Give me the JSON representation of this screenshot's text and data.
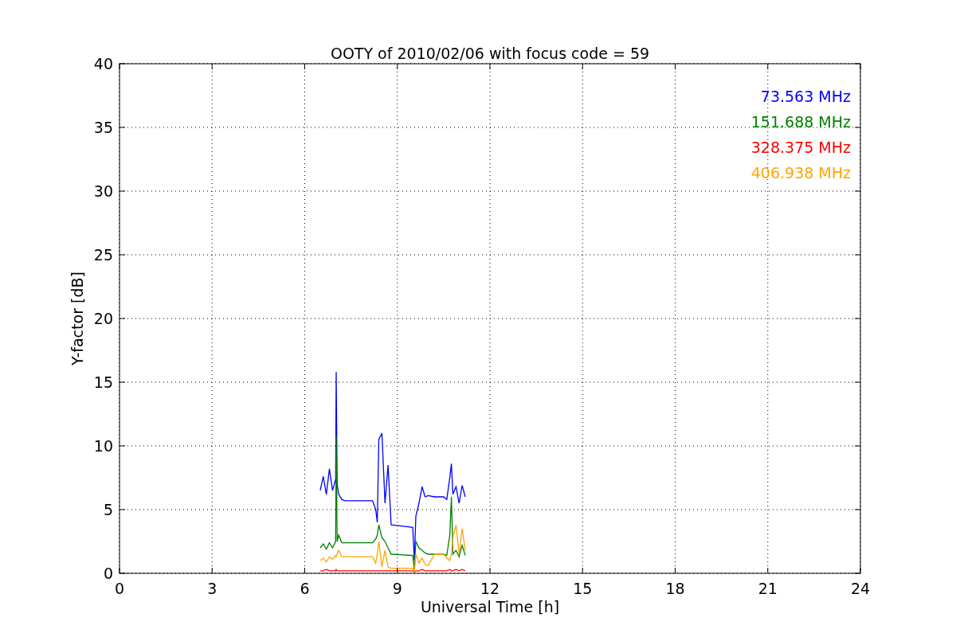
{
  "figure": {
    "chart_data": {
      "type": "line",
      "title": "OOTY of 2010/02/06 with focus code = 59",
      "xlabel": "Universal Time [h]",
      "ylabel": "Y-factor [dB]",
      "x": [
        6.5,
        6.6,
        6.7,
        6.8,
        6.9,
        7.0,
        7.02,
        7.05,
        7.1,
        7.2,
        7.3,
        8.2,
        8.3,
        8.35,
        8.4,
        8.5,
        8.6,
        8.7,
        8.8,
        9.5,
        9.55,
        9.6,
        9.7,
        9.8,
        9.9,
        10.0,
        10.2,
        10.5,
        10.6,
        10.7,
        10.75,
        10.8,
        10.9,
        11.0,
        11.1,
        11.2
      ],
      "series": [
        {
          "name": "73.563 MHz",
          "color": "#0000ff",
          "values": [
            6.5,
            7.6,
            6.2,
            8.2,
            6.5,
            7.4,
            15.8,
            7.0,
            6.2,
            5.8,
            5.7,
            5.7,
            5.0,
            4.0,
            10.5,
            11.0,
            5.5,
            8.5,
            3.8,
            3.6,
            1.0,
            4.5,
            5.5,
            6.8,
            6.0,
            6.1,
            6.0,
            6.0,
            5.8,
            7.5,
            8.6,
            6.2,
            6.8,
            5.5,
            6.9,
            6.0
          ]
        },
        {
          "name": "151.688 MHz",
          "color": "#008000",
          "values": [
            2.0,
            2.3,
            1.9,
            2.4,
            2.0,
            2.5,
            10.8,
            2.5,
            3.0,
            2.4,
            2.4,
            2.4,
            2.7,
            3.0,
            3.8,
            2.8,
            2.5,
            2.0,
            1.5,
            1.4,
            0.3,
            2.5,
            2.0,
            1.8,
            1.6,
            1.5,
            1.5,
            1.5,
            1.4,
            3.0,
            6.0,
            1.5,
            1.8,
            1.3,
            2.2,
            1.4
          ]
        },
        {
          "name": "328.375 MHz",
          "color": "#ff0000",
          "values": [
            0.2,
            0.2,
            0.3,
            0.2,
            0.2,
            0.2,
            0.3,
            0.2,
            0.2,
            0.2,
            0.2,
            0.2,
            0.2,
            0.2,
            0.2,
            0.2,
            0.2,
            0.2,
            0.2,
            0.2,
            0.1,
            0.2,
            0.2,
            0.3,
            0.2,
            0.2,
            0.2,
            0.2,
            0.2,
            0.3,
            0.2,
            0.2,
            0.3,
            0.2,
            0.3,
            0.2
          ]
        },
        {
          "name": "406.938 MHz",
          "color": "#ffa500",
          "values": [
            1.0,
            1.2,
            0.9,
            1.3,
            1.1,
            1.4,
            1.3,
            1.5,
            1.8,
            1.3,
            1.3,
            1.3,
            0.8,
            1.5,
            2.5,
            0.5,
            1.8,
            0.5,
            0.4,
            0.4,
            0.1,
            1.5,
            0.8,
            1.2,
            0.7,
            0.6,
            1.5,
            1.5,
            1.2,
            1.0,
            1.5,
            2.8,
            3.8,
            1.5,
            3.5,
            1.8
          ]
        }
      ],
      "xlim": [
        0,
        24
      ],
      "ylim": [
        0,
        40
      ],
      "grid": true,
      "xticks": [
        0,
        3,
        6,
        9,
        12,
        15,
        18,
        21,
        24
      ],
      "yticks": [
        0,
        5,
        10,
        15,
        20,
        25,
        30,
        35,
        40
      ]
    }
  }
}
